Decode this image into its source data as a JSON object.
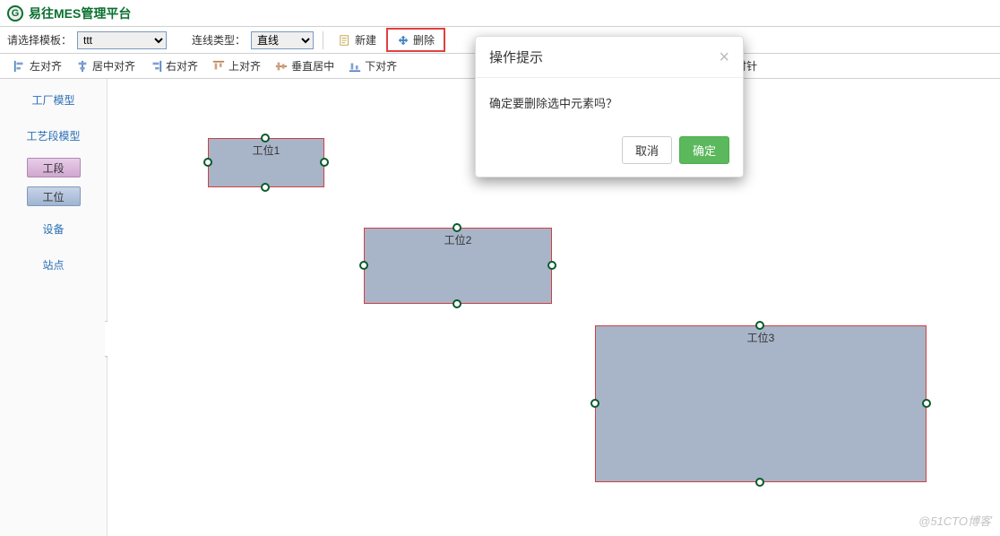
{
  "header": {
    "app_title": "易往MES管理平台"
  },
  "toolbar1": {
    "template_label": "请选择模板：",
    "template_value": "ttt",
    "line_type_label": "连线类型：",
    "line_type_value": "直线",
    "new_btn": "新建",
    "delete_btn": "删除"
  },
  "toolbar2": {
    "align_left": "左对齐",
    "align_center_h": "居中对齐",
    "align_right": "右对齐",
    "align_top": "上对齐",
    "align_center_v": "垂直居中",
    "align_bottom": "下对齐",
    "rotate_ccw": "逆时针"
  },
  "sidebar": {
    "items": [
      {
        "label": "工厂模型"
      },
      {
        "label": "工艺段模型"
      },
      {
        "label": "工段"
      },
      {
        "label": "工位"
      },
      {
        "label": "设备"
      },
      {
        "label": "站点"
      }
    ],
    "collapse": "‹"
  },
  "canvas": {
    "nodes": [
      {
        "label": "工位1"
      },
      {
        "label": "工位2"
      },
      {
        "label": "工位3"
      }
    ]
  },
  "modal": {
    "title": "操作提示",
    "message": "确定要删除选中元素吗？",
    "cancel": "取消",
    "ok": "确定",
    "close": "×"
  },
  "watermark": "@51CTO博客"
}
